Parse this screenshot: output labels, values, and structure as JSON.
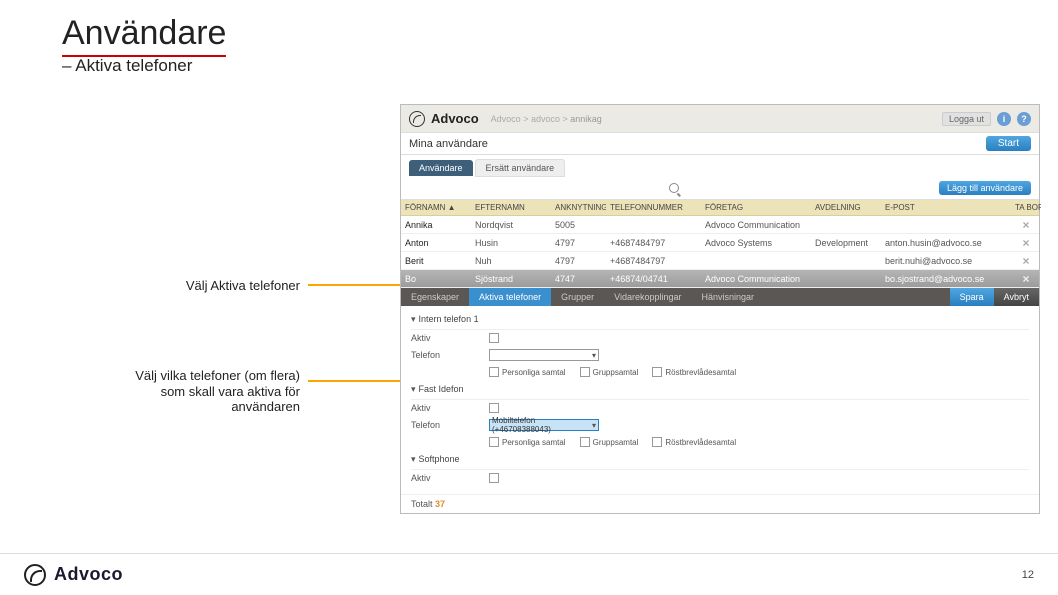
{
  "slide": {
    "title": "Användare",
    "subtitle": "– Aktiva telefoner",
    "page_number": "12"
  },
  "annotation1": "Välj Aktiva telefoner",
  "annotation2": "Välj vilka telefoner (om flera) som skall vara aktiva för användaren",
  "app": {
    "name": "Advoco",
    "breadcrumb": "annikag",
    "logout": "Logga ut"
  },
  "panel": {
    "section_title": "Mina användare",
    "start_btn": "Start",
    "tab_active": "Användare",
    "tab_inactive": "Ersätt användare",
    "add_user": "Lägg till användare",
    "save": "Spara",
    "cancel": "Avbryt",
    "totalt_label": "Totalt",
    "totalt_count": "37"
  },
  "table": {
    "headers": [
      "FÖRNAMN ▲",
      "EFTERNAMN",
      "ANKNYTNING",
      "TELEFONNUMMER",
      "FÖRETAG",
      "AVDELNING",
      "E-POST",
      "TA BORT"
    ],
    "rows": [
      {
        "first": "Annika",
        "last": "Nordqvist",
        "ext": "5005",
        "phone": "",
        "company": "Advoco Communication",
        "dept": "",
        "email": ""
      },
      {
        "first": "Anton",
        "last": "Husin",
        "ext": "4797",
        "phone": "+4687484797",
        "company": "Advoco Systems",
        "dept": "Development",
        "email": "anton.husin@advoco.se"
      },
      {
        "first": "Berit",
        "last": "Nuh",
        "ext": "4797",
        "phone": "+4687484797",
        "company": "",
        "dept": "",
        "email": "berit.nuhi@advoco.se"
      },
      {
        "first": "Bo",
        "last": "Sjöstrand",
        "ext": "4747",
        "phone": "+46874/04741",
        "company": "Advoco Communication",
        "dept": "",
        "email": "bo.sjostrand@advoco.se"
      }
    ]
  },
  "detail": {
    "tabs": [
      "Egenskaper",
      "Aktiva telefoner",
      "Grupper",
      "Vidarekopplingar",
      "Hänvisningar"
    ],
    "active_tab": "Aktiva telefoner",
    "section_intern": "Intern telefon 1",
    "section_fast": "Fast Idefon",
    "section_softphone": "Softphone",
    "label_aktiv": "Aktiv",
    "label_telefon": "Telefon",
    "dropdown_value": "Mobiltelefon (+46708388043)",
    "chk_personal": "Personliga samtal",
    "chk_group": "Gruppsamtal",
    "chk_voicemail": "Röstbrevlådesamtal"
  },
  "footer": {
    "brand": "Advoco"
  }
}
